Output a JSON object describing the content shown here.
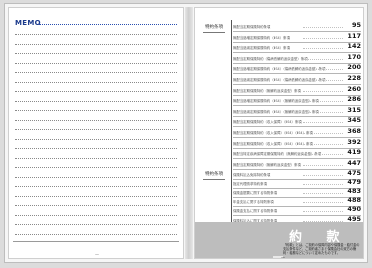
{
  "memo": {
    "title": "MEMO"
  },
  "left_page": {
    "page_number": "—"
  },
  "toc": {
    "section1": {
      "label": "特約条項"
    },
    "section2": {
      "label": "特約条項"
    },
    "entries": [
      {
        "text": "無配当定期保険特約条項",
        "page": "95"
      },
      {
        "text": "無配当逓増定期保険特約（ⅡS4）条項",
        "page": "117"
      },
      {
        "text": "無配当逓減定期保険特約（ⅡS4）条項",
        "page": "142"
      },
      {
        "text": "無配当定期保険特約（傷病低解約返戻金型）条項",
        "page": "170"
      },
      {
        "text": "無配当逓増定期保険特約（ⅡS4）（傷病低解約返戻金型）条項",
        "page": "200"
      },
      {
        "text": "無配当逓減定期保険特約（ⅡS4）（傷病低解約返戻金型）条項",
        "page": "228"
      },
      {
        "text": "無配当定期保険特約（無解約返戻金型）条項",
        "page": "260"
      },
      {
        "text": "無配当逓増定期保険特約（ⅡS4）（無解約返戻金型）条項",
        "page": "286"
      },
      {
        "text": "無配当逓減定期保険特約（ⅡS4）（無解約返戻金型）条項",
        "page": "315"
      },
      {
        "text": "無配当定期保険特約（収入保障）（ⅡS4）条項",
        "page": "345"
      },
      {
        "text": "無配当定期保険特約（収入保障）（ⅡS4）（ⅡS4）条項",
        "page": "368"
      },
      {
        "text": "無配当定期保険特約（収入保障）（ⅡS4）（ⅡS4）条項",
        "page": "392"
      },
      {
        "text": "無配当特定疾病保障定期保険特約（無解約返戻金型）条項",
        "page": "419"
      },
      {
        "text": "無配当定期保険特約（無解約返戻金型）条項",
        "page": "447"
      },
      {
        "text": "保険料払込免除特約条項",
        "page": "475"
      },
      {
        "text": "指定代理請求特約条項",
        "page": "479"
      },
      {
        "text": "保険金据置に関する特則条項",
        "page": "483"
      },
      {
        "text": "年金支払に関する特則条項",
        "page": "488"
      },
      {
        "text": "保険金支払に関する特則条項",
        "page": "490"
      },
      {
        "text": "保険料払込に関する特則条項",
        "page": "495"
      }
    ]
  },
  "box": {
    "title": "約 款",
    "note": "「約款」とは、ご契約の保障内容や保険金・給付金の支払条件など、ご契約者さまと保険会社の双方の権利・義務などについて定めたものです。",
    "page_number": "—"
  },
  "colors": {
    "memo_blue": "#1b3a8c",
    "box_gray": "#bdbdbd"
  }
}
